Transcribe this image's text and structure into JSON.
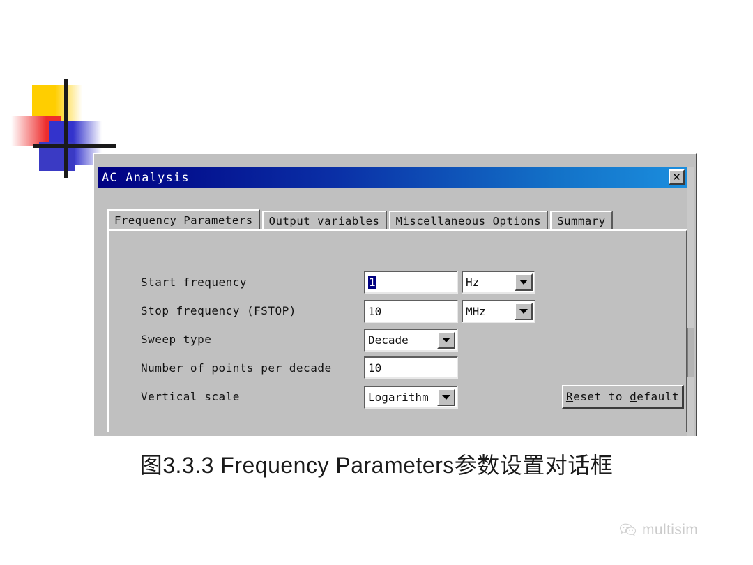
{
  "decoration": {
    "colors": {
      "yellow": "#FFCE00",
      "red": "#EE2D2D",
      "blue": "#3333CC",
      "cross": "#1a1a1a"
    }
  },
  "dialog": {
    "title": "AC Analysis",
    "close_label": "✕",
    "titlebar_gradient_from": "#000082",
    "titlebar_gradient_to": "#1b8ede",
    "face_color": "#c0c0c0",
    "tabs": [
      {
        "label": "Frequency Parameters",
        "active": true
      },
      {
        "label": "Output variables",
        "active": false
      },
      {
        "label": "Miscellaneous Options",
        "active": false
      },
      {
        "label": "Summary",
        "active": false
      }
    ],
    "form": {
      "rows": [
        {
          "label": "Start frequency",
          "value": "1",
          "selected": true,
          "unit": "Hz"
        },
        {
          "label": "Stop frequency (FSTOP)",
          "value": "10",
          "selected": false,
          "unit": "MHz"
        },
        {
          "label": "Sweep type",
          "value": "Decade"
        },
        {
          "label": "Number of points per decade",
          "value": "10"
        },
        {
          "label": "Vertical scale",
          "value": "Logarithm"
        }
      ]
    },
    "reset_button": {
      "prefix": "",
      "accel1": "R",
      "mid": "eset to ",
      "accel2": "d",
      "suffix": "efault",
      "full_label": "Reset to default"
    }
  },
  "caption": "图3.3.3 Frequency Parameters参数设置对话框",
  "watermark": {
    "text": "multisim",
    "logo": "wechat-bubbles-icon"
  }
}
